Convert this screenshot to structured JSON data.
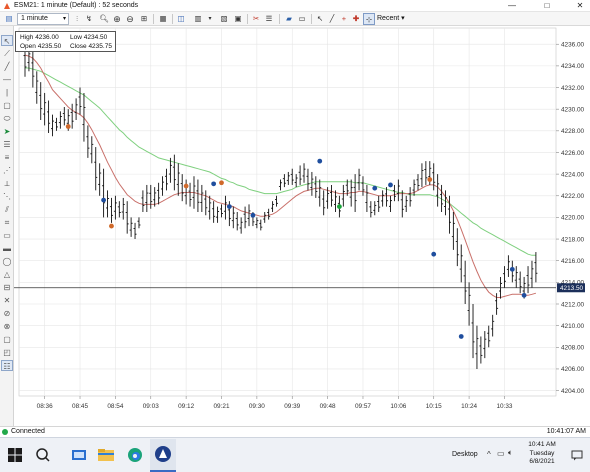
{
  "window": {
    "title": "ESM21: 1 minute (Default) : 52 seconds",
    "minimize_glyph": "—",
    "maximize_glyph": "□",
    "close_glyph": "✕"
  },
  "toolbar": {
    "timeframe": "1 minute",
    "recent_label": "Recent",
    "icons": [
      "chart-style-icon",
      "zoom-in-icon",
      "zoom-out-icon",
      "bar-type-icon",
      "indicators-icon",
      "strategies-icon",
      "templates-icon",
      "properties-icon",
      "pointer-icon",
      "draw-line-icon",
      "crosshair-icon",
      "global-crosshair-icon"
    ]
  },
  "ohlc": {
    "high_label": "High",
    "high_value": "4236.00",
    "low_label": "Low",
    "low_value": "4234.50",
    "open_label": "Open",
    "open_value": "4235.50",
    "close_label": "Close",
    "close_value": "4235.75"
  },
  "price_axis": [
    "4236.00",
    "4234.00",
    "4232.00",
    "4230.00",
    "4228.00",
    "4226.00",
    "4224.00",
    "4222.00",
    "4220.00",
    "4218.00",
    "4216.00",
    "4214.00",
    "4212.00",
    "4210.00",
    "4208.00",
    "4206.00",
    "4204.00"
  ],
  "current_price": "4213.50",
  "time_axis": [
    "08:36",
    "08:45",
    "08:54",
    "09:03",
    "09:12",
    "09:21",
    "09:30",
    "09:39",
    "09:48",
    "09:57",
    "10:06",
    "10:15",
    "10:24",
    "10:33"
  ],
  "colors": {
    "bar": "#111111",
    "marker_blue": "#1f4e9e",
    "marker_orange": "#d0692a",
    "marker_green": "#1aa33a",
    "ma_fast": "#c9706a",
    "ma_slow": "#7fd07f",
    "price_line": "#333333",
    "price_tag": "#1c2f5a"
  },
  "chart_data": {
    "type": "ohlc",
    "symbol": "ESM21",
    "interval": "1 minute",
    "ylim": [
      4203.5,
      4237.5
    ],
    "x": [
      "08:31",
      "08:32",
      "08:33",
      "08:34",
      "08:35",
      "08:36",
      "08:37",
      "08:38",
      "08:39",
      "08:40",
      "08:41",
      "08:42",
      "08:43",
      "08:44",
      "08:45",
      "08:46",
      "08:47",
      "08:48",
      "08:49",
      "08:50",
      "08:51",
      "08:52",
      "08:53",
      "08:54",
      "08:55",
      "08:56",
      "08:57",
      "08:58",
      "08:59",
      "09:00",
      "09:01",
      "09:02",
      "09:03",
      "09:04",
      "09:05",
      "09:06",
      "09:07",
      "09:08",
      "09:09",
      "09:10",
      "09:11",
      "09:12",
      "09:13",
      "09:14",
      "09:15",
      "09:16",
      "09:17",
      "09:18",
      "09:19",
      "09:20",
      "09:21",
      "09:22",
      "09:23",
      "09:24",
      "09:25",
      "09:26",
      "09:27",
      "09:28",
      "09:29",
      "09:30",
      "09:31",
      "09:32",
      "09:33",
      "09:34",
      "09:35",
      "09:36",
      "09:37",
      "09:38",
      "09:39",
      "09:40",
      "09:41",
      "09:42",
      "09:43",
      "09:44",
      "09:45",
      "09:46",
      "09:47",
      "09:48",
      "09:49",
      "09:50",
      "09:51",
      "09:52",
      "09:53",
      "09:54",
      "09:55",
      "09:56",
      "09:57",
      "09:58",
      "09:59",
      "10:00",
      "10:01",
      "10:02",
      "10:03",
      "10:04",
      "10:05",
      "10:06",
      "10:07",
      "10:08",
      "10:09",
      "10:10",
      "10:11",
      "10:12",
      "10:13",
      "10:14",
      "10:15",
      "10:16",
      "10:17",
      "10:18",
      "10:19",
      "10:20",
      "10:21",
      "10:22",
      "10:23",
      "10:24",
      "10:25",
      "10:26",
      "10:27",
      "10:28",
      "10:29",
      "10:30",
      "10:31",
      "10:32",
      "10:33",
      "10:34",
      "10:35",
      "10:36",
      "10:37",
      "10:38",
      "10:39",
      "10:40",
      "10:41"
    ],
    "high": [
      4236.0,
      4235.8,
      4235.5,
      4233.5,
      4232.5,
      4231.5,
      4230.8,
      4229.5,
      4229.2,
      4229.8,
      4230.2,
      4230.0,
      4230.5,
      4231.0,
      4232.0,
      4231.5,
      4228.5,
      4227.5,
      4226.5,
      4225.0,
      4224.5,
      4222.5,
      4221.8,
      4222.0,
      4221.5,
      4221.8,
      4221.5,
      4220.0,
      4219.5,
      4219.0,
      4222.5,
      4223.0,
      4223.0,
      4222.8,
      4223.2,
      4223.8,
      4224.5,
      4225.5,
      4225.8,
      4225.0,
      4224.0,
      4223.5,
      4223.2,
      4223.8,
      4223.5,
      4223.0,
      4222.5,
      4222.0,
      4221.5,
      4221.0,
      4221.2,
      4222.0,
      4221.5,
      4221.0,
      4220.5,
      4220.0,
      4221.0,
      4221.2,
      4220.5,
      4220.0,
      4219.8,
      4220.5,
      4220.8,
      4221.5,
      4222.0,
      4223.5,
      4224.0,
      4224.2,
      4224.5,
      4224.0,
      4224.8,
      4225.0,
      4224.5,
      4224.2,
      4223.8,
      4223.5,
      4222.5,
      4222.8,
      4223.0,
      4222.5,
      4222.0,
      4223.0,
      4223.5,
      4223.5,
      4224.0,
      4224.5,
      4223.8,
      4223.0,
      4221.5,
      4221.5,
      4222.0,
      4222.5,
      4222.8,
      4222.0,
      4223.0,
      4223.5,
      4222.5,
      4222.0,
      4222.8,
      4223.5,
      4224.0,
      4225.0,
      4225.2,
      4225.2,
      4225.0,
      4224.0,
      4223.0,
      4222.5,
      4222.0,
      4220.5,
      4219.0,
      4217.5,
      4216.0,
      4214.0,
      4212.0,
      4210.0,
      4209.0,
      4209.5,
      4210.0,
      4211.0,
      4213.0,
      4214.5,
      4215.5,
      4216.5,
      4216.0,
      4215.5,
      4215.0,
      4214.5,
      4215.5,
      4216.0,
      4216.8
    ],
    "low": [
      4233.0,
      4233.5,
      4232.0,
      4230.5,
      4229.0,
      4228.5,
      4227.8,
      4227.5,
      4228.0,
      4228.2,
      4228.5,
      4228.0,
      4228.2,
      4229.0,
      4229.5,
      4227.0,
      4225.5,
      4225.0,
      4222.5,
      4222.0,
      4220.0,
      4220.0,
      4219.5,
      4219.8,
      4220.0,
      4219.8,
      4218.5,
      4218.2,
      4218.0,
      4220.0,
      4220.5,
      4220.5,
      4220.8,
      4221.0,
      4221.2,
      4222.0,
      4222.5,
      4223.2,
      4222.5,
      4222.0,
      4221.5,
      4221.2,
      4221.0,
      4220.8,
      4220.5,
      4220.5,
      4220.2,
      4219.8,
      4219.5,
      4219.5,
      4220.0,
      4219.8,
      4219.2,
      4219.0,
      4218.8,
      4218.5,
      4219.0,
      4219.2,
      4219.2,
      4219.0,
      4218.8,
      4219.5,
      4219.8,
      4220.5,
      4221.0,
      4222.5,
      4222.8,
      4223.0,
      4223.0,
      4222.8,
      4223.0,
      4223.2,
      4222.5,
      4222.0,
      4221.8,
      4221.0,
      4220.2,
      4220.8,
      4221.0,
      4220.5,
      4220.0,
      4221.0,
      4222.0,
      4221.0,
      4220.5,
      4222.5,
      4222.0,
      4220.5,
      4220.0,
      4220.2,
      4220.5,
      4221.0,
      4221.0,
      4220.5,
      4221.5,
      4221.5,
      4220.0,
      4220.5,
      4221.0,
      4222.0,
      4222.5,
      4222.8,
      4223.0,
      4223.0,
      4222.5,
      4221.0,
      4220.5,
      4220.2,
      4218.5,
      4217.0,
      4215.5,
      4214.0,
      4212.0,
      4210.0,
      4207.0,
      4206.0,
      4206.5,
      4207.0,
      4208.0,
      4209.0,
      4211.0,
      4212.5,
      4213.5,
      4214.5,
      4214.0,
      4213.5,
      4213.0,
      4212.5,
      4213.0,
      4213.5,
      4214.0
    ],
    "markers": [
      {
        "x": "08:51",
        "y": 4221.6,
        "color": "blue"
      },
      {
        "x": "08:53",
        "y": 4219.2,
        "color": "orange"
      },
      {
        "x": "09:12",
        "y": 4222.9,
        "color": "orange"
      },
      {
        "x": "09:19",
        "y": 4223.1,
        "color": "blue"
      },
      {
        "x": "09:21",
        "y": 4223.2,
        "color": "orange"
      },
      {
        "x": "09:23",
        "y": 4221.0,
        "color": "blue"
      },
      {
        "x": "09:29",
        "y": 4220.2,
        "color": "blue"
      },
      {
        "x": "09:46",
        "y": 4225.2,
        "color": "blue"
      },
      {
        "x": "10:00",
        "y": 4222.7,
        "color": "blue"
      },
      {
        "x": "10:04",
        "y": 4223.0,
        "color": "blue"
      },
      {
        "x": "10:14",
        "y": 4223.5,
        "color": "orange"
      },
      {
        "x": "10:15",
        "y": 4216.6,
        "color": "blue"
      },
      {
        "x": "10:22",
        "y": 4209.0,
        "color": "blue"
      },
      {
        "x": "10:35",
        "y": 4215.2,
        "color": "blue"
      },
      {
        "x": "10:38",
        "y": 4212.8,
        "color": "blue"
      },
      {
        "x": "08:42",
        "y": 4228.4,
        "color": "orange"
      },
      {
        "x": "09:51",
        "y": 4221.0,
        "color": "green"
      }
    ],
    "ma_fast": [
      4235.0,
      4234.9,
      4234.7,
      4234.3,
      4233.8,
      4233.1,
      4232.5,
      4231.8,
      4231.4,
      4231.0,
      4230.6,
      4230.2,
      4229.9,
      4229.7,
      4229.5,
      4229.2,
      4228.7,
      4228.1,
      4227.4,
      4226.7,
      4225.9,
      4225.1,
      4224.4,
      4223.7,
      4223.1,
      4222.6,
      4222.1,
      4221.8,
      4221.5,
      4221.3,
      4221.2,
      4221.2,
      4221.2,
      4221.2,
      4221.3,
      4221.5,
      4221.7,
      4221.9,
      4222.1,
      4222.2,
      4222.3,
      4222.3,
      4222.3,
      4222.3,
      4222.2,
      4222.1,
      4222.0,
      4221.8,
      4221.6,
      4221.4,
      4221.3,
      4221.2,
      4221.1,
      4221.0,
      4220.8,
      4220.6,
      4220.5,
      4220.4,
      4220.3,
      4220.2,
      4220.1,
      4220.1,
      4220.2,
      4220.3,
      4220.5,
      4220.8,
      4221.1,
      4221.4,
      4221.7,
      4222.0,
      4222.2,
      4222.4,
      4222.5,
      4222.6,
      4222.7,
      4222.7,
      4222.6,
      4222.5,
      4222.4,
      4222.3,
      4222.2,
      4222.2,
      4222.2,
      4222.3,
      4222.3,
      4222.4,
      4222.4,
      4222.3,
      4222.2,
      4222.1,
      4222.0,
      4222.0,
      4222.0,
      4222.0,
      4222.1,
      4222.2,
      4222.2,
      4222.2,
      4222.2,
      4222.3,
      4222.5,
      4222.7,
      4222.9,
      4223.0,
      4223.0,
      4222.8,
      4222.4,
      4221.9,
      4221.3,
      4220.6,
      4219.8,
      4218.9,
      4217.9,
      4216.9,
      4215.9,
      4215.0,
      4214.2,
      4213.6,
      4213.1,
      4212.8,
      4212.6,
      4212.6,
      4212.7,
      4212.8,
      4212.9,
      4212.9,
      4212.9,
      4212.8,
      4212.8,
      4212.9,
      4213.0
    ],
    "ma_slow": [
      4233.8,
      4233.8,
      4233.7,
      4233.6,
      4233.5,
      4233.3,
      4233.1,
      4232.9,
      4232.7,
      4232.5,
      4232.3,
      4232.1,
      4231.9,
      4231.7,
      4231.5,
      4231.3,
      4231.0,
      4230.7,
      4230.4,
      4230.1,
      4229.7,
      4229.3,
      4228.9,
      4228.5,
      4228.1,
      4227.8,
      4227.4,
      4227.1,
      4226.8,
      4226.5,
      4226.3,
      4226.1,
      4225.9,
      4225.7,
      4225.5,
      4225.4,
      4225.3,
      4225.2,
      4225.1,
      4225.0,
      4224.9,
      4224.8,
      4224.7,
      4224.6,
      4224.5,
      4224.4,
      4224.3,
      4224.2,
      4224.0,
      4223.8,
      4223.6,
      4223.5,
      4223.3,
      4223.2,
      4223.0,
      4222.9,
      4222.8,
      4222.6,
      4222.5,
      4222.4,
      4222.3,
      4222.2,
      4222.2,
      4222.2,
      4222.2,
      4222.3,
      4222.4,
      4222.5,
      4222.6,
      4222.8,
      4222.9,
      4223.0,
      4223.1,
      4223.2,
      4223.3,
      4223.3,
      4223.3,
      4223.3,
      4223.3,
      4223.3,
      4223.3,
      4223.3,
      4223.3,
      4223.3,
      4223.2,
      4223.2,
      4223.2,
      4223.1,
      4223.0,
      4222.9,
      4222.8,
      4222.7,
      4222.6,
      4222.5,
      4222.4,
      4222.3,
      4222.3,
      4222.2,
      4222.1,
      4222.1,
      4222.1,
      4222.1,
      4222.1,
      4222.1,
      4222.0,
      4221.9,
      4221.7,
      4221.5,
      4221.3,
      4221.0,
      4220.7,
      4220.4,
      4220.1,
      4219.8,
      4219.5,
      4219.3,
      4219.0,
      4218.8,
      4218.6,
      4218.4,
      4218.2,
      4218.0,
      4217.8,
      4217.6,
      4217.4,
      4217.2,
      4217.0,
      4216.8,
      4216.6,
      4216.5,
      4216.5
    ],
    "price_line": 4213.5
  },
  "statusbar": {
    "connection": "Connected",
    "time": "10:41:07 AM"
  },
  "taskbar": {
    "desktop_label": "Desktop",
    "clock_time": "10:41 AM",
    "clock_day": "Tuesday",
    "clock_date": "6/8/2021",
    "caret": "^"
  }
}
